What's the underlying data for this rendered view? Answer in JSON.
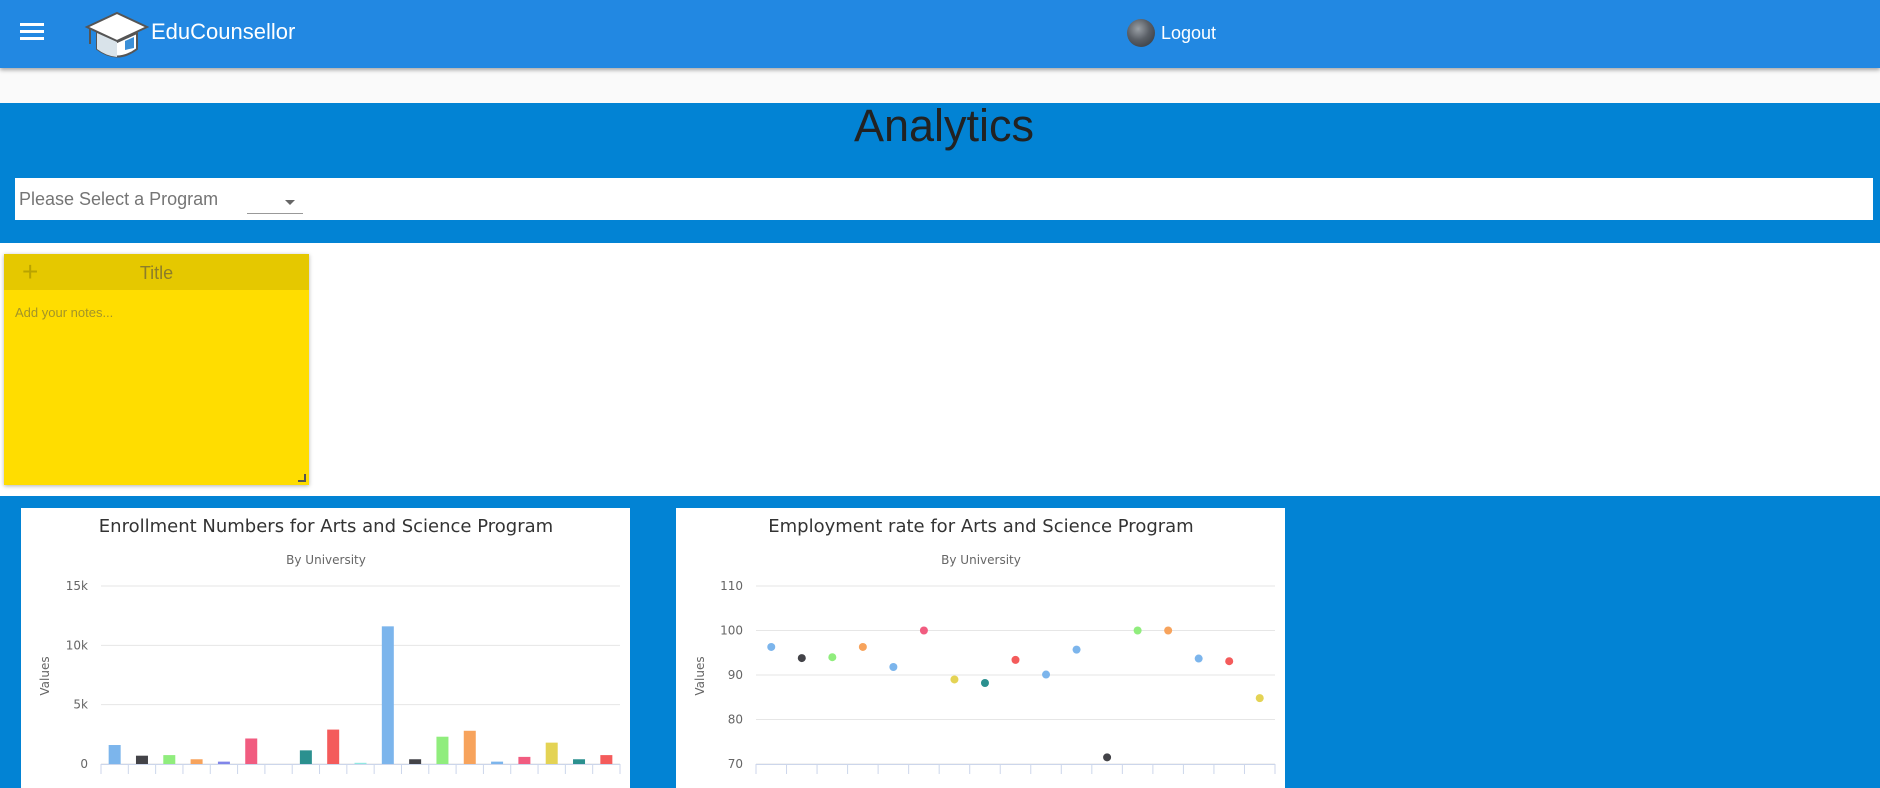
{
  "app": {
    "brand": "EduCounsellor",
    "logout_label": "Logout"
  },
  "page": {
    "title": "Analytics"
  },
  "program_select": {
    "placeholder": "Please Select a Program"
  },
  "sticky_note": {
    "title": "Title",
    "placeholder": "Add your notes..."
  },
  "colors": {
    "appbar": "#2288e2",
    "page_bg": "#0283d4",
    "sticky": "#ffdd00",
    "sticky_head": "#e5c800"
  },
  "charts": [
    {
      "title": "Enrollment Numbers for Arts and Science Program",
      "subtitle": "By University",
      "ylabel": "Values",
      "chart_data": {
        "type": "bar",
        "ylim": [
          0,
          15000
        ],
        "yticks": [
          "0",
          "5k",
          "10k",
          "15k"
        ],
        "ytick_values": [
          0,
          5000,
          10000,
          15000
        ],
        "grid": true,
        "values": [
          1600,
          700,
          750,
          400,
          200,
          2150,
          0,
          1150,
          2900,
          100,
          11600,
          400,
          2300,
          2800,
          200,
          600,
          1800,
          400,
          750
        ],
        "colors": [
          "#7cb5ec",
          "#434348",
          "#90ed7d",
          "#f7a35c",
          "#8085e9",
          "#f15c80",
          "#e4d354",
          "#2b908f",
          "#f45b5b",
          "#91e8e1",
          "#7cb5ec",
          "#434348",
          "#90ed7d",
          "#f7a35c",
          "#7cb5ec",
          "#f15c80",
          "#e4d354",
          "#2b908f",
          "#f45b5b"
        ]
      }
    },
    {
      "title": "Employment rate for Arts and Science Program",
      "subtitle": "By University",
      "ylabel": "Values",
      "chart_data": {
        "type": "scatter",
        "ylim": [
          70,
          110
        ],
        "yticks": [
          "70",
          "80",
          "90",
          "100",
          "110"
        ],
        "ytick_values": [
          70,
          80,
          90,
          100,
          110
        ],
        "grid": true,
        "values": [
          96.3,
          93.8,
          94,
          96.3,
          91.8,
          100,
          89,
          88.2,
          93.4,
          90.1,
          95.7,
          71.5,
          100,
          100,
          93.7,
          93.1,
          84.8
        ],
        "colors": [
          "#7cb5ec",
          "#434348",
          "#90ed7d",
          "#f7a35c",
          "#7cb5ec",
          "#f15c80",
          "#e4d354",
          "#2b908f",
          "#f45b5b",
          "#7cb5ec",
          "#7cb5ec",
          "#434348",
          "#90ed7d",
          "#f7a35c",
          "#7cb5ec",
          "#f45b5b",
          "#e4d354"
        ]
      }
    }
  ]
}
